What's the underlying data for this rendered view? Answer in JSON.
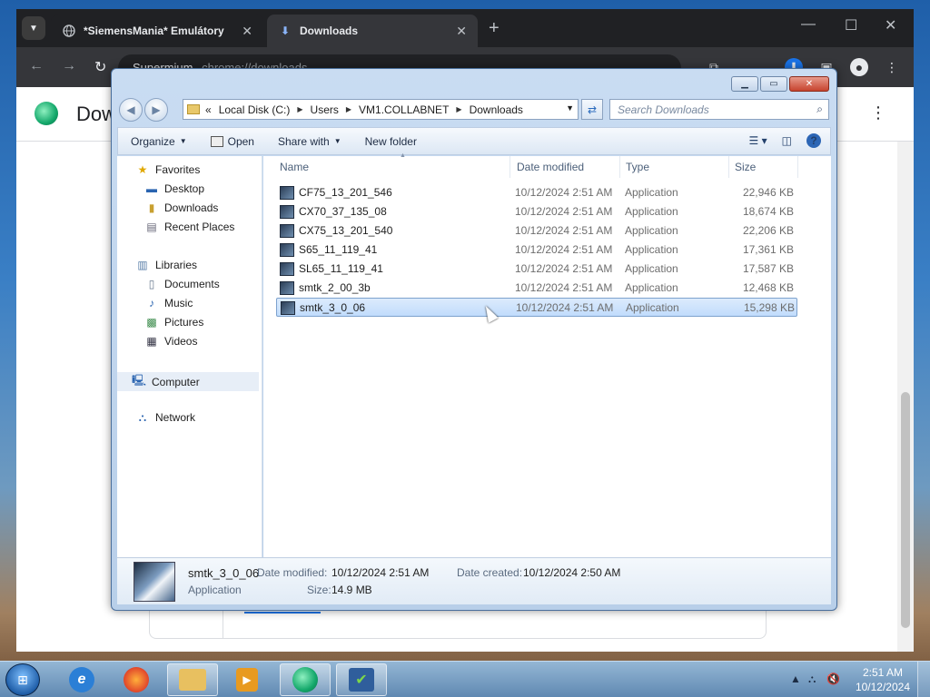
{
  "chrome": {
    "tabs": [
      {
        "title": "*SiemensMania* Emulátory",
        "close": "✕"
      },
      {
        "title": "Downloads",
        "close": "✕"
      }
    ],
    "new_tab": "+",
    "omnibox": {
      "site": "Supermium",
      "url": "chrome://downloads"
    },
    "page_title": "Downloads"
  },
  "explorer": {
    "breadcrumb": [
      "Local Disk (C:)",
      "Users",
      "VM1.COLLABNET",
      "Downloads"
    ],
    "breadcrumb_prefix": "«",
    "search_placeholder": "Search Downloads",
    "commands": {
      "organize": "Organize",
      "open": "Open",
      "share_with": "Share with",
      "new_folder": "New folder"
    },
    "nav": {
      "favorites": "Favorites",
      "desktop": "Desktop",
      "downloads": "Downloads",
      "recent_places": "Recent Places",
      "libraries": "Libraries",
      "documents": "Documents",
      "music": "Music",
      "pictures": "Pictures",
      "videos": "Videos",
      "computer": "Computer",
      "network": "Network"
    },
    "columns": {
      "name": "Name",
      "date": "Date modified",
      "type": "Type",
      "size": "Size"
    },
    "files": [
      {
        "name": "CF75_13_201_546",
        "date": "10/12/2024 2:51 AM",
        "type": "Application",
        "size": "22,946 KB"
      },
      {
        "name": "CX70_37_135_08",
        "date": "10/12/2024 2:51 AM",
        "type": "Application",
        "size": "18,674 KB"
      },
      {
        "name": "CX75_13_201_540",
        "date": "10/12/2024 2:51 AM",
        "type": "Application",
        "size": "22,206 KB"
      },
      {
        "name": "S65_11_119_41",
        "date": "10/12/2024 2:51 AM",
        "type": "Application",
        "size": "17,361 KB"
      },
      {
        "name": "SL65_11_119_41",
        "date": "10/12/2024 2:51 AM",
        "type": "Application",
        "size": "17,587 KB"
      },
      {
        "name": "smtk_2_00_3b",
        "date": "10/12/2024 2:51 AM",
        "type": "Application",
        "size": "12,468 KB"
      },
      {
        "name": "smtk_3_0_06",
        "date": "10/12/2024 2:51 AM",
        "type": "Application",
        "size": "15,298 KB"
      }
    ],
    "selected_index": 6,
    "details": {
      "name": "smtk_3_0_06",
      "type": "Application",
      "date_modified_label": "Date modified:",
      "date_modified": "10/12/2024 2:51 AM",
      "date_created_label": "Date created:",
      "date_created": "10/12/2024 2:50 AM",
      "size_label": "Size:",
      "size": "14.9 MB"
    }
  },
  "taskbar": {
    "clock_time": "2:51 AM",
    "clock_date": "10/12/2024",
    "apps": [
      "ie-icon",
      "firefox-icon",
      "explorer-icon",
      "media-player-icon",
      "supermium-icon",
      "installer-icon"
    ]
  },
  "colors": {
    "selection": "#c1dcfc",
    "chrome_dark": "#202124",
    "accent": "#1a73e8"
  }
}
